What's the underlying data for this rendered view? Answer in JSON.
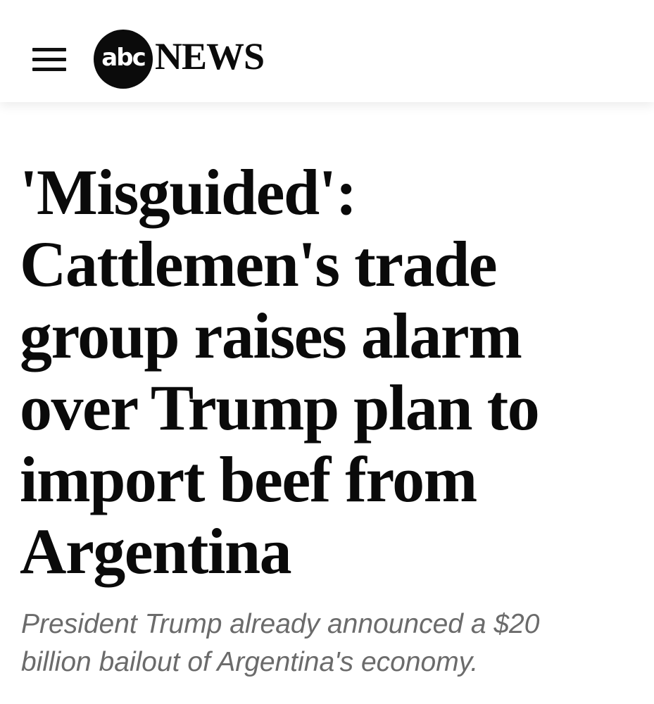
{
  "header": {
    "menu_icon": "hamburger-menu-icon",
    "logo": {
      "circle_text": "abc",
      "word": "NEWS"
    }
  },
  "article": {
    "headline_lines": [
      "'Misguided':",
      "Cattlemen's trade",
      "group raises alarm",
      "over Trump plan to",
      "import beef from",
      "Argentina"
    ],
    "subhead_lines": [
      "President Trump already announced a $20",
      "billion bailout of Argentina's economy."
    ]
  },
  "colors": {
    "background": "#ffffff",
    "headline": "#0a0a0a",
    "subhead": "#6b6b6b",
    "logo": "#0b0b0b"
  }
}
